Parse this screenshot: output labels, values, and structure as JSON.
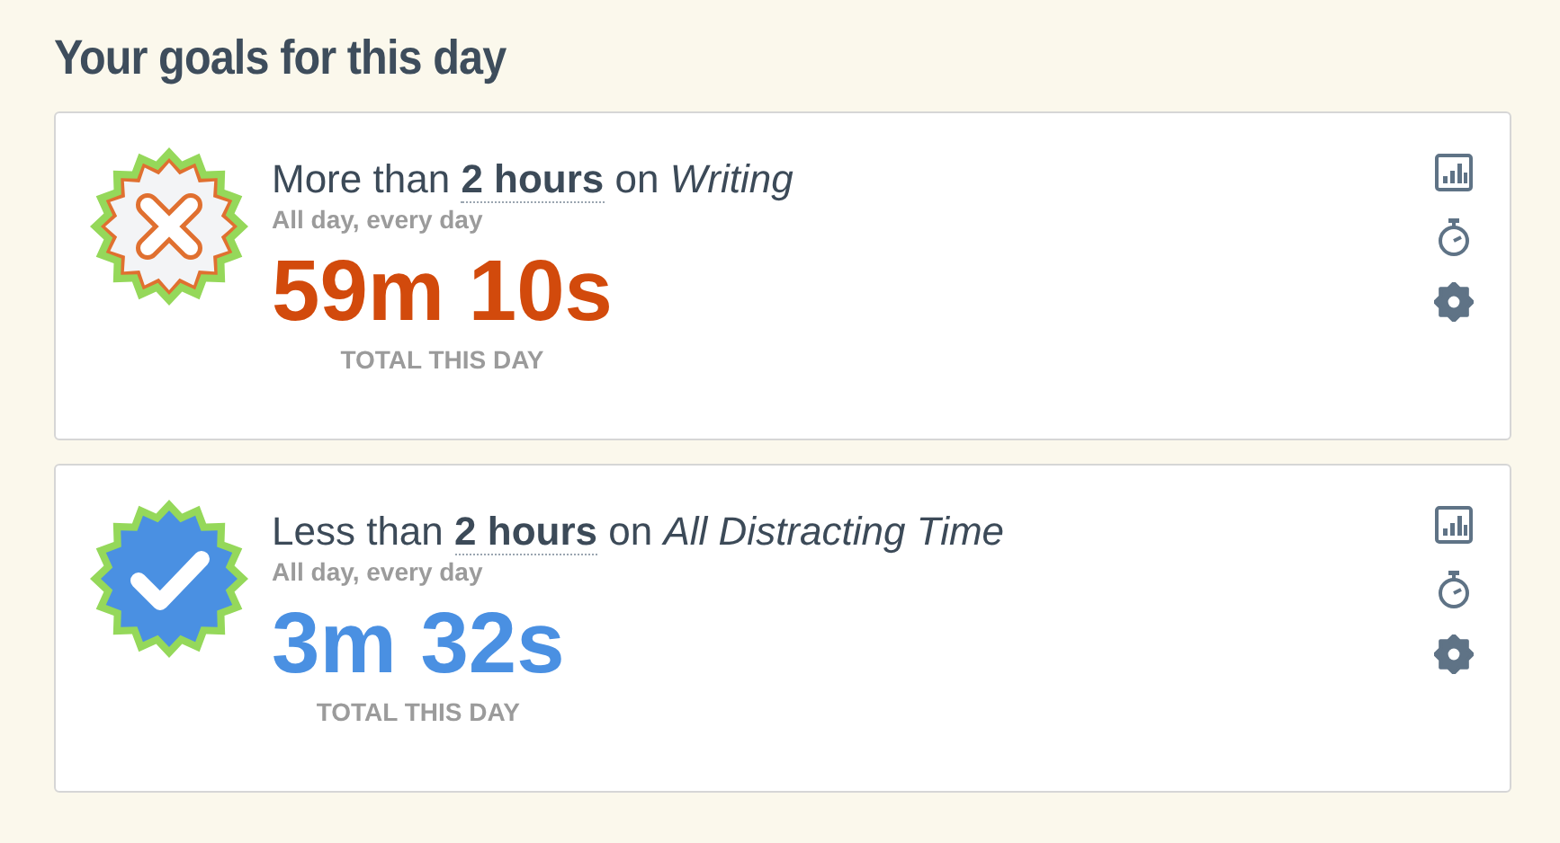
{
  "heading": "Your goals for this day",
  "goals": [
    {
      "met": false,
      "comparison": "More than",
      "amount": "2 hours",
      "on": "on",
      "category": "Writing",
      "schedule": "All day, every day",
      "total": "59m 10s",
      "total_label": "TOTAL THIS DAY"
    },
    {
      "met": true,
      "comparison": "Less than",
      "amount": "2 hours",
      "on": "on",
      "category": "All Distracting Time",
      "schedule": "All day, every day",
      "total": "3m 32s",
      "total_label": "TOTAL THIS DAY"
    }
  ]
}
